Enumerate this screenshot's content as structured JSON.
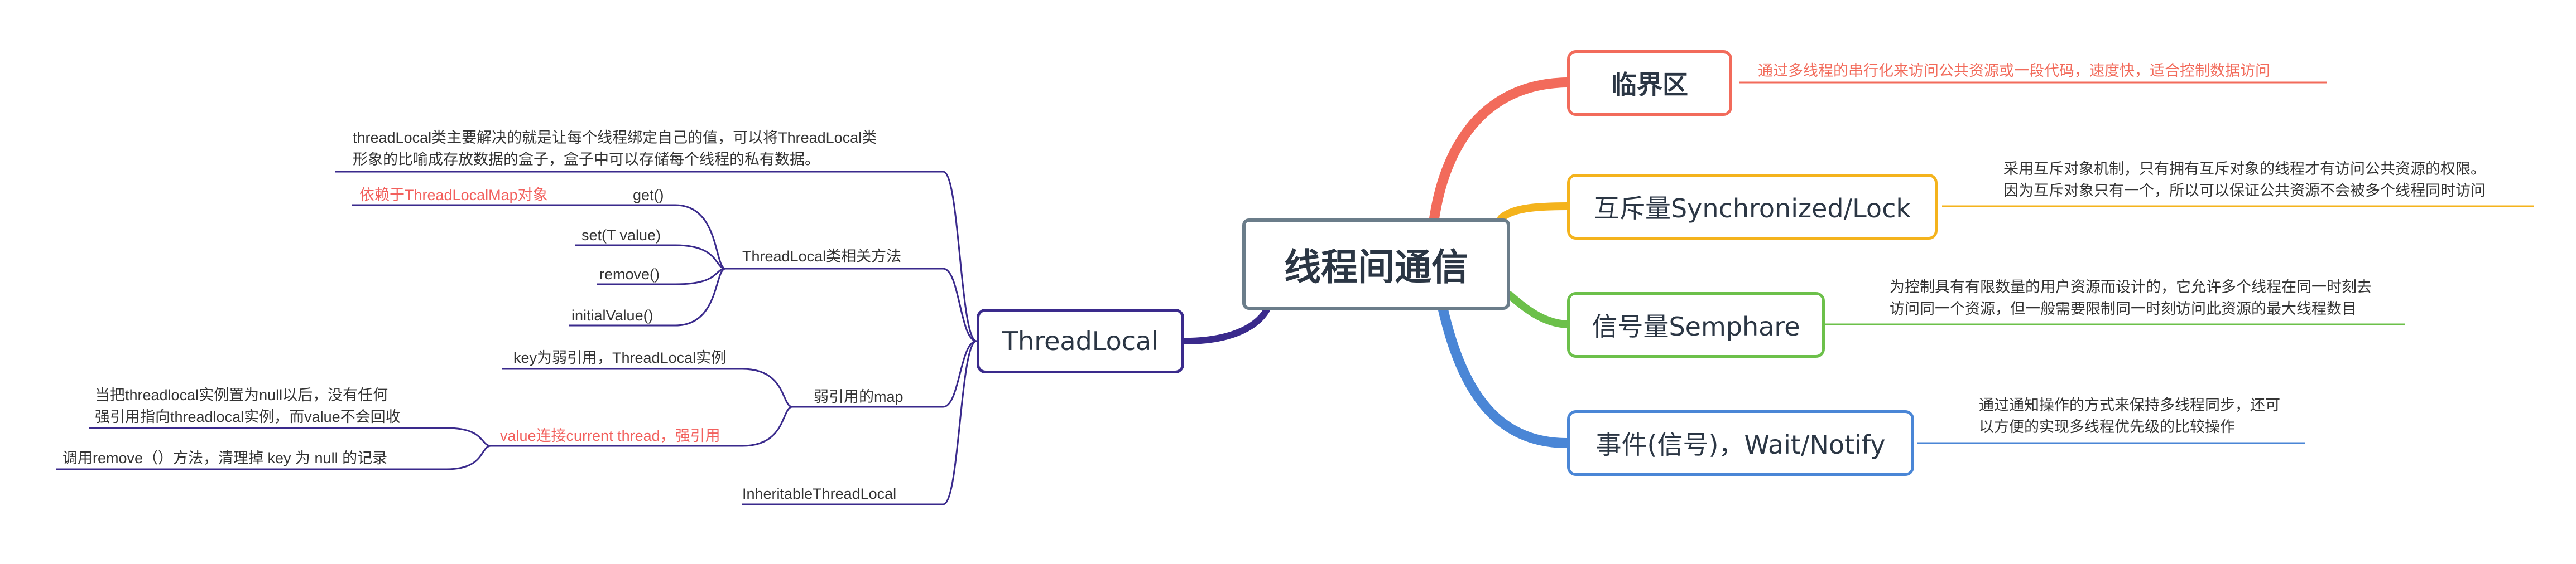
{
  "root": {
    "label": "线程间通信"
  },
  "right_branches": [
    {
      "label": "临界区",
      "description": "通过多线程的串行化来访问公共资源或一段代码，速度快，适合控制数据访问",
      "color": "#f26b5b"
    },
    {
      "label": "互斥量Synchronized/Lock",
      "description_lines": [
        "采用互斥对象机制，只有拥有互斥对象的线程才有访问公共资源的权限。",
        "因为互斥对象只有一个，所以可以保证公共资源不会被多个线程同时访问"
      ],
      "color": "#f4b31c"
    },
    {
      "label": "信号量Semphare",
      "description_lines": [
        "为控制具有有限数量的用户资源而设计的，它允许多个线程在同一时刻去",
        "访问同一个资源，但一般需要限制同一时刻访问此资源的最大线程数目"
      ],
      "color": "#6cc04a"
    },
    {
      "label": "事件(信号)，Wait/Notify",
      "description_lines": [
        "通过通知操作的方式来保持多线程同步，还可",
        "以方便的实现多线程优先级的比较操作"
      ],
      "color": "#4a86d6"
    }
  ],
  "left_branch": {
    "label": "ThreadLocal",
    "color": "#3a2a8c",
    "intro_lines": [
      "threadLocal类主要解决的就是让每个线程绑定自己的值，可以将ThreadLocal类",
      "形象的比喻成存放数据的盒子，盒子中可以存储每个线程的私有数据。"
    ],
    "methods": {
      "label": "ThreadLocal类相关方法",
      "items": [
        "get()",
        "set(T value)",
        "remove()",
        "initialValue()"
      ],
      "get_note": "依赖于ThreadLocalMap对象"
    },
    "weak_map": {
      "label": "弱引用的map",
      "key_item": "key为弱引用，ThreadLocal实例",
      "value_item": "value连接current thread，强引用",
      "value_note_lines": [
        "当把threadlocal实例置为null以后，没有任何",
        "强引用指向threadlocal实例，而value不会回收"
      ],
      "remove_note": "调用remove（）方法，清理掉 key 为 null 的记录"
    },
    "inheritable": "InheritableThreadLocal"
  }
}
